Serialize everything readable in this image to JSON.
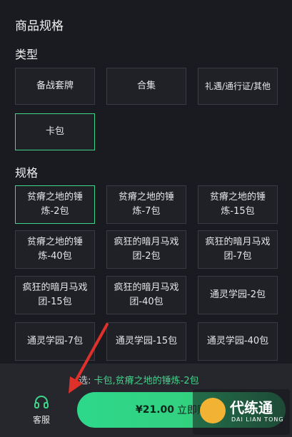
{
  "sheet": {
    "title": "商品规格"
  },
  "type_section": {
    "label": "类型",
    "options": [
      {
        "label": "备战套牌",
        "selected": false
      },
      {
        "label": "合集",
        "selected": false
      },
      {
        "label": "礼遇/通行证/其他",
        "selected": false
      },
      {
        "label": "卡包",
        "selected": true
      }
    ]
  },
  "spec_section": {
    "label": "规格",
    "options": [
      {
        "label": "贫瘠之地的锤\n炼-2包",
        "selected": true
      },
      {
        "label": "贫瘠之地的锤\n炼-7包",
        "selected": false
      },
      {
        "label": "贫瘠之地的锤\n炼-15包",
        "selected": false
      },
      {
        "label": "贫瘠之地的锤\n炼-40包",
        "selected": false
      },
      {
        "label": "疯狂的暗月马戏\n团-2包",
        "selected": false
      },
      {
        "label": "疯狂的暗月马戏\n团-7包",
        "selected": false
      },
      {
        "label": "疯狂的暗月马戏\n团-15包",
        "selected": false
      },
      {
        "label": "疯狂的暗月马戏\n团-40包",
        "selected": false
      },
      {
        "label": "通灵学园-2包",
        "selected": false
      },
      {
        "label": "通灵学园-7包",
        "selected": false
      },
      {
        "label": "通灵学园-15包",
        "selected": false
      },
      {
        "label": "通灵学园-40包",
        "selected": false
      }
    ]
  },
  "bottom": {
    "selected_prefix": "选:",
    "selected_value": "卡包,贫瘠之地的锤炼-2包",
    "service_label": "客服",
    "price": "¥21.00",
    "buy_label": "立即购买"
  },
  "watermark": {
    "text": "代练通",
    "sub": "DAI LIAN TONG"
  },
  "colors": {
    "accent": "#3fd58a",
    "panel": "#1a1b20",
    "option_bg": "#202127",
    "arrow": "#e0302a"
  }
}
